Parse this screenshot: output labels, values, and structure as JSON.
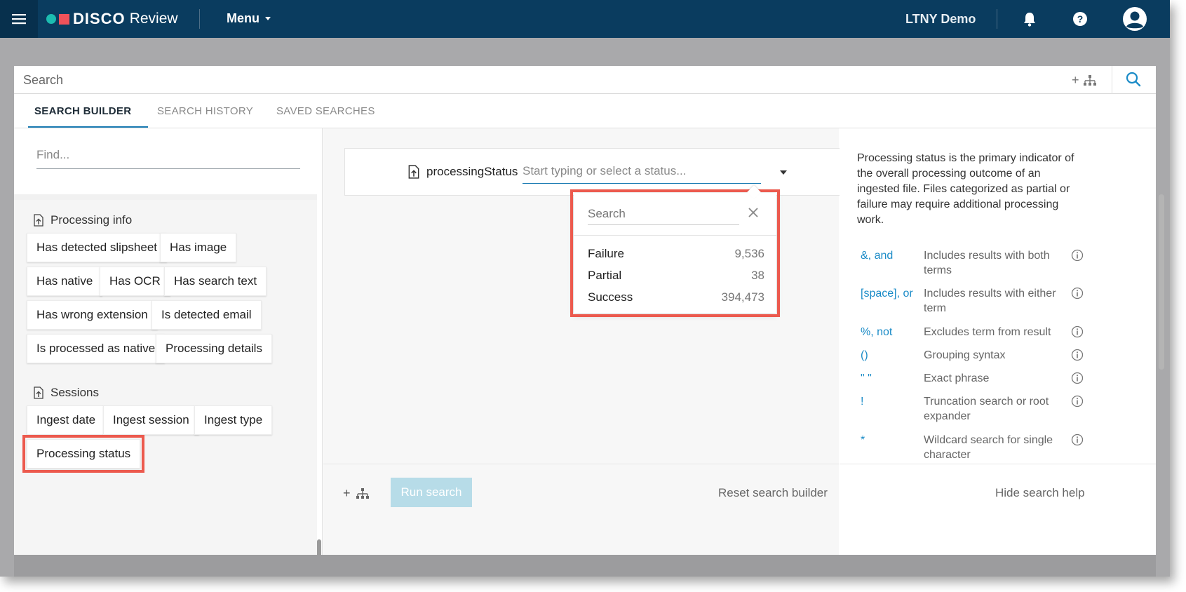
{
  "app": {
    "brand": "DISCO",
    "brand_sub": "Review",
    "menu_label": "Menu",
    "user_name": "LTNY Demo"
  },
  "search": {
    "placeholder": "Search",
    "add_symbol": "+"
  },
  "tabs": [
    {
      "label": "SEARCH BUILDER",
      "active": true
    },
    {
      "label": "SEARCH HISTORY",
      "active": false
    },
    {
      "label": "SAVED SEARCHES",
      "active": false
    }
  ],
  "left": {
    "find_placeholder": "Find...",
    "groups": [
      {
        "title": "Processing info",
        "chips": [
          "Has detected slipsheet",
          "Has image",
          "Has native",
          "Has OCR",
          "Has search text",
          "Has wrong extension",
          "Is detected email",
          "Is processed as native",
          "Processing details"
        ]
      },
      {
        "title": "Sessions",
        "chips": [
          "Ingest date",
          "Ingest session",
          "Ingest type",
          "Processing status"
        ]
      }
    ]
  },
  "condition": {
    "field": "processingStatus",
    "input_placeholder": "Start typing or select a status..."
  },
  "dropdown": {
    "search_placeholder": "Search",
    "options": [
      {
        "label": "Failure",
        "count": "9,536"
      },
      {
        "label": "Partial",
        "count": "38"
      },
      {
        "label": "Success",
        "count": "394,473"
      }
    ]
  },
  "footer": {
    "add_symbol": "+",
    "run_label": "Run search",
    "reset_label": "Reset search builder",
    "hide_help_label": "Hide search help"
  },
  "help": {
    "description": "Processing status is the primary indicator of the overall processing outcome of an ingested file. Files categorized as partial or failure may require additional processing work.",
    "operators": [
      {
        "symbol": "&,  and",
        "desc": "Includes results with both terms"
      },
      {
        "symbol": "[space],  or",
        "desc": "Includes results with either term"
      },
      {
        "symbol": "%,  not",
        "desc": "Excludes term from result"
      },
      {
        "symbol": "()",
        "desc": "Grouping syntax"
      },
      {
        "symbol": "\" \"",
        "desc": "Exact phrase"
      },
      {
        "symbol": "!",
        "desc": "Truncation search or root expander"
      },
      {
        "symbol": "*",
        "desc": "Wildcard search for single character"
      }
    ]
  },
  "colors": {
    "topbar": "#0a3c5f",
    "accent": "#1a8bc7",
    "highlight": "#ec5a4e",
    "run_button": "#b7dce8"
  }
}
